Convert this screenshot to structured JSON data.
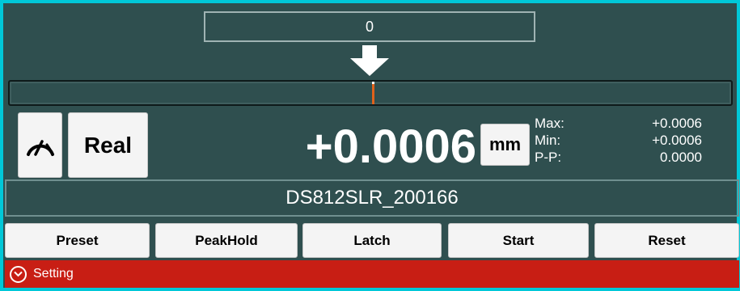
{
  "indicator": {
    "value": "0"
  },
  "colors": {
    "accent": "#e0621b",
    "setting_bar": "#c81e14",
    "panel": "#2f4f4f"
  },
  "scale": {
    "position_fraction": 0.5
  },
  "controls": {
    "gauge_icon": "speedometer-icon",
    "mode_label": "Real",
    "unit_label": "mm"
  },
  "measurement": {
    "reading": "+0.0006"
  },
  "stats": {
    "max_label": "Max:",
    "max_value": "+0.0006",
    "min_label": "Min:",
    "min_value": "+0.0006",
    "pp_label": "P-P:",
    "pp_value": "0.0000"
  },
  "device": {
    "name": "DS812SLR_200166"
  },
  "actions": {
    "preset": "Preset",
    "peakhold": "PeakHold",
    "latch": "Latch",
    "start": "Start",
    "reset": "Reset"
  },
  "setting": {
    "label": "Setting",
    "icon": "chevron-down-icon"
  }
}
